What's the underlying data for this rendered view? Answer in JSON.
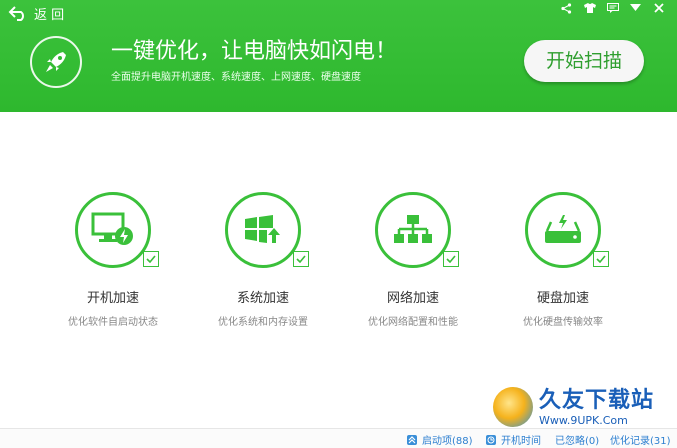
{
  "header": {
    "back_label": "返 回",
    "headline": "一键优化，让电脑快如闪电！",
    "subline": "全面提升电脑开机速度、系统速度、上网速度、硬盘速度",
    "scan_button": "开始扫描",
    "window_icons": [
      "share-icon",
      "skin-icon",
      "feedback-icon",
      "menu-icon",
      "close-icon"
    ]
  },
  "features": [
    {
      "title": "开机加速",
      "desc": "优化软件自启动状态",
      "icon": "monitor-boost-icon",
      "checked": true
    },
    {
      "title": "系统加速",
      "desc": "优化系统和内存设置",
      "icon": "windows-icon",
      "checked": true
    },
    {
      "title": "网络加速",
      "desc": "优化网络配置和性能",
      "icon": "network-icon",
      "checked": true
    },
    {
      "title": "硬盘加速",
      "desc": "优化硬盘传输效率",
      "icon": "harddisk-icon",
      "checked": true
    }
  ],
  "statusbar": {
    "startup_items": "启动项(88)",
    "boot_time": "开机时间",
    "ignored": "已忽略(0)",
    "history": "优化记录(31)"
  },
  "watermark": {
    "brand": "久友下载站",
    "url": "Www.9UPK.Com"
  },
  "colors": {
    "header_green": "#2eb82e",
    "accent_green": "#3ac03a",
    "status_blue": "#2c7fd0"
  }
}
